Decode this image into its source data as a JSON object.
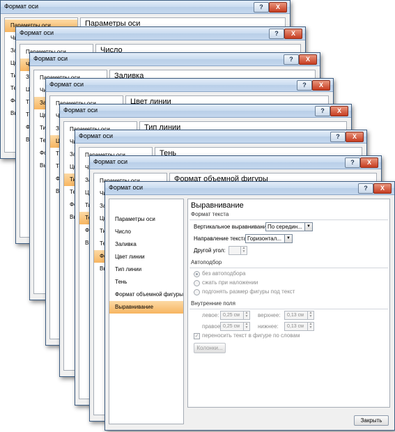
{
  "title": "Формат оси",
  "help_glyph": "?",
  "close_glyph": "X",
  "nav_items": [
    "Параметры оси",
    "Число",
    "Заливка",
    "Цвет линии",
    "Тип линии",
    "Тень",
    "Формат объемной фигуры",
    "Выравнивание"
  ],
  "back_dialogs": [
    {
      "header": "Параметры оси",
      "selected_index": 0
    },
    {
      "header": "Число",
      "selected_index": 1
    },
    {
      "header": "Заливка",
      "selected_index": 2
    },
    {
      "header": "Цвет линии",
      "selected_index": 3
    },
    {
      "header": "Тип линии",
      "selected_index": 4
    },
    {
      "header": "Тень",
      "selected_index": 5
    },
    {
      "header": "Формат объемной фигуры",
      "selected_index": 6
    }
  ],
  "front": {
    "header": "Выравнивание",
    "selected_index": 7,
    "text_format": {
      "section": "Формат текста",
      "vertical_label": "Вертикальное выравнивание:",
      "vertical_value": "По середин...",
      "direction_label": "Направление текста:",
      "direction_value": "Горизонтал...",
      "angle_label": "Другой угол:",
      "angle_value": ""
    },
    "autofit": {
      "section": "Автоподбор",
      "options": [
        "без автоподбора",
        "сжать при наложении",
        "подгонять размер фигуры под текст"
      ],
      "selected": 0
    },
    "inner_margins": {
      "section": "Внутренние поля",
      "left_label": "левое:",
      "left_value": "0,25 см",
      "top_label": "верхнее:",
      "top_value": "0,13 см",
      "right_label": "правое:",
      "right_value": "0,25 см",
      "bottom_label": "нижнее:",
      "bottom_value": "0,13 см",
      "wrap_label": "переносить текст в фигуре по словам",
      "wrap_checked": true,
      "columns_button": "Колонки..."
    },
    "close_button": "Закрыть"
  }
}
